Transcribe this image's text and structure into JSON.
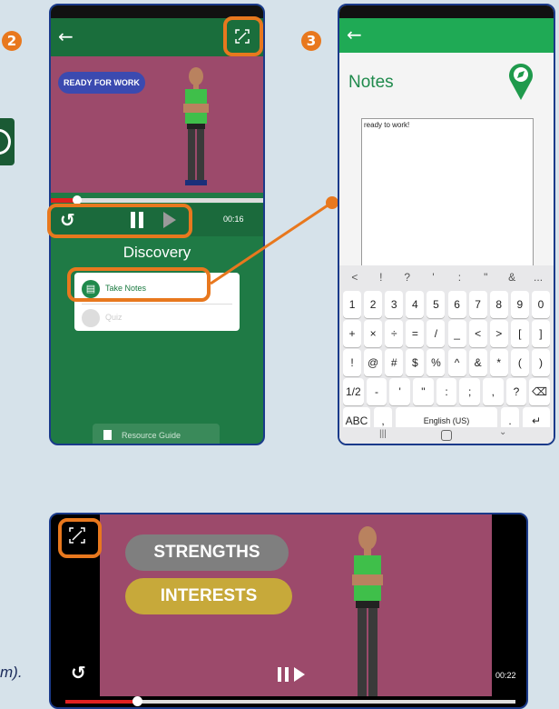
{
  "badges": {
    "step2": "2",
    "step3": "3"
  },
  "phone1": {
    "video": {
      "banner": "READY FOR WORK",
      "time": "00:16",
      "progress": 0.14
    },
    "title": "Discovery",
    "menu": [
      {
        "label": "Take Notes"
      },
      {
        "label": "Quiz"
      }
    ],
    "resource_guide": "Resource Guide"
  },
  "phone2": {
    "title": "Notes",
    "note_text": "ready to work!",
    "keyboard": {
      "top_row": [
        "<",
        "!",
        "?",
        "'",
        ":",
        "\"",
        "&",
        "..."
      ],
      "row1": [
        "1",
        "2",
        "3",
        "4",
        "5",
        "6",
        "7",
        "8",
        "9",
        "0"
      ],
      "row2": [
        "+",
        "×",
        "÷",
        "=",
        "/",
        "_",
        "<",
        ">",
        "[",
        "]"
      ],
      "row3": [
        "!",
        "@",
        "#",
        "$",
        "%",
        "^",
        "&",
        "*",
        "(",
        ")"
      ],
      "row4": [
        "1/2",
        "-",
        "'",
        "\"",
        ":",
        ";",
        ",",
        "?",
        "⌫"
      ],
      "row5": {
        "abc": "ABC",
        "comma": ",",
        "space": "English (US)",
        "period": ".",
        "enter": "↵"
      }
    }
  },
  "landscape": {
    "labels": {
      "strengths": "STRENGTHS",
      "interests": "INTERESTS"
    },
    "time": "00:22",
    "progress": 0.16
  },
  "caption_fragment": "m).",
  "colors": {
    "green": "#1f8a4c",
    "dark_green": "#176b3b",
    "maroon": "#9c4a6b",
    "orange": "#e8781e"
  }
}
